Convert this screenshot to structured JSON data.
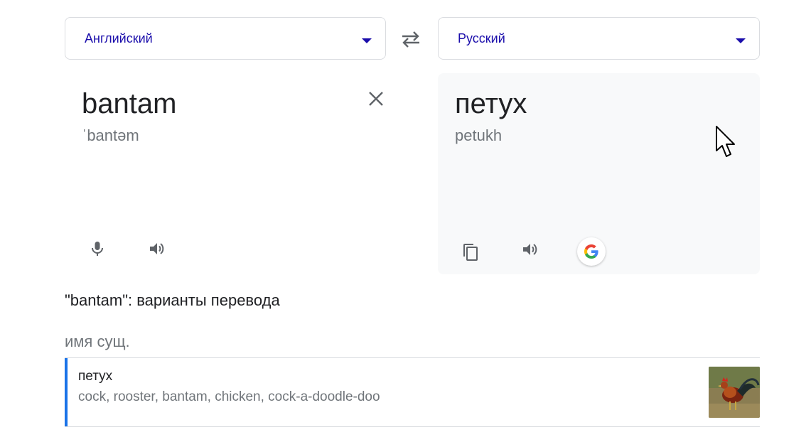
{
  "languages": {
    "source": "Английский",
    "target": "Русский"
  },
  "source": {
    "text": "bantam",
    "transcription": "ˈbantəm"
  },
  "translation": {
    "text": "петух",
    "transliteration": "petukh"
  },
  "icons": {
    "swap": "swap-icon",
    "clear": "close-icon",
    "mic": "microphone-icon",
    "speaker": "speaker-icon",
    "copy": "copy-icon",
    "google": "google-logo-icon",
    "caret": "caret-down-icon",
    "cursor": "mouse-cursor-icon"
  },
  "variants": {
    "heading": "\"bantam\": варианты перевода",
    "part_of_speech": "имя сущ.",
    "entries": [
      {
        "word": "петух",
        "synonyms": "cock, rooster, bantam, chicken, cock-a-doodle-doo"
      }
    ]
  },
  "colors": {
    "link": "#1a0dab",
    "accent": "#1a73e8",
    "muted": "#70757a",
    "panel_bg": "#f8f9fa",
    "border": "#dadce0"
  }
}
